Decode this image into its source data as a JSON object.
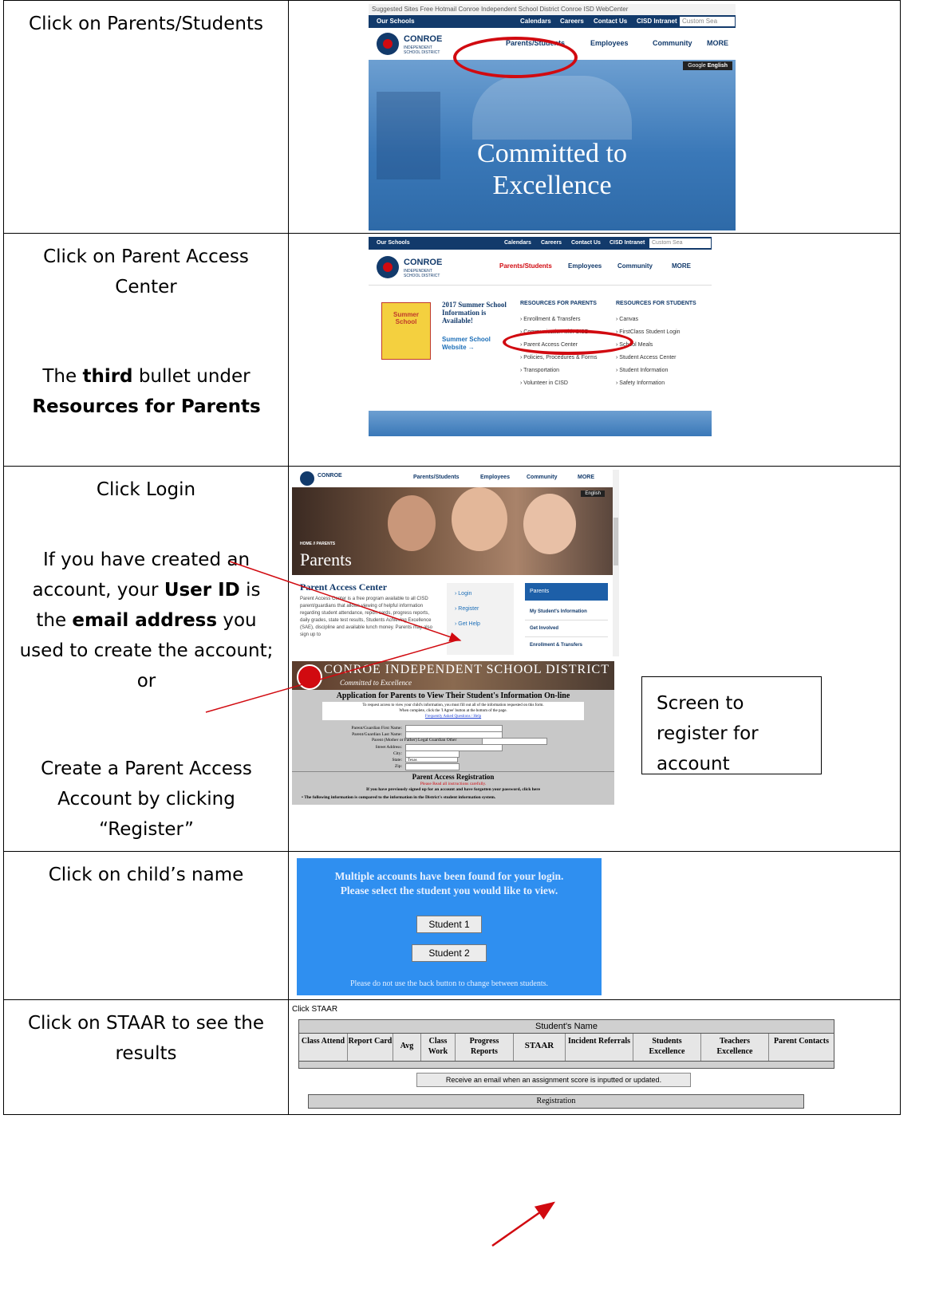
{
  "rows": [
    {
      "instruction": "Click on Parents/Students",
      "shot": {
        "browser_bar": "Suggested Sites  Free Hotmail  Conroe Independent School District  Conroe ISD WebCenter",
        "util_links": [
          "Our Schools",
          "Calendars",
          "Careers",
          "Contact Us",
          "CISD Intranet",
          "Custom Sea"
        ],
        "logo_name": "CONROE",
        "logo_sub": "INDEPENDENT SCHOOL DISTRICT",
        "nav": [
          "Parents/Students",
          "Employees",
          "Community",
          "MORE"
        ],
        "translate": "Google",
        "language": "English",
        "hero_line1": "Committed to",
        "hero_line2": "Excellence"
      }
    },
    {
      "instruction": "Click on Parent Access Center",
      "note_pre": "The ",
      "note_em": "third",
      "note_mid": " bullet under ",
      "note_strong": "Resources for Parents",
      "shot": {
        "util_links": [
          "Our Schools",
          "Calendars",
          "Careers",
          "Contact Us",
          "CISD Intranet",
          "Custom Sea"
        ],
        "logo_name": "CONROE",
        "logo_sub": "INDEPENDENT SCHOOL DISTRICT",
        "nav": [
          "Parents/Students",
          "Employees",
          "Community",
          "MORE"
        ],
        "promo_title": "2017 Summer School Information is Available!",
        "promo_link": "Summer School Website →",
        "promo_img": "Summer School",
        "parents_heading": "RESOURCES FOR PARENTS",
        "parents_items": [
          "Enrollment & Transfers",
          "Communication with CISD",
          "Parent Access Center",
          "Policies, Procedures & Forms",
          "Transportation",
          "Volunteer in CISD"
        ],
        "students_heading": "RESOURCES FOR STUDENTS",
        "students_items": [
          "Canvas",
          "FirstClass Student Login",
          "School Meals",
          "Student Access Center",
          "Student Information",
          "Safety Information"
        ]
      }
    },
    {
      "instruction": "Click Login",
      "note1_a": "If you have created an account, your ",
      "note1_b": "User ID",
      "note1_c": " is the ",
      "note1_d": "email address",
      "note1_e": " you used to create the account; or",
      "note2": "Create a Parent Access Account by clicking “Register”",
      "callout": "Screen to register for account",
      "shot_a": {
        "logo_name": "CONROE",
        "nav": [
          "Parents/Students",
          "Employees",
          "Community",
          "MORE"
        ],
        "language": "English",
        "crumb": "HOME // PARENTS",
        "page_title": "Parents",
        "pac_title": "Parent Access Center",
        "pac_body": "Parent Access Center is a free program available to all CISD parent/guardians that allows viewing of helpful information regarding student attendance, report cards, progress reports, daily grades, state test results, Students Achieving Excellence (SAE), discipline and available lunch money. Parents may also sign up to",
        "links": [
          "Login",
          "Register",
          "Get Help"
        ],
        "side_heading": "Parents",
        "side_items": [
          "My Student's Information",
          "Get Involved",
          "Enrollment & Transfers"
        ]
      },
      "shot_b": {
        "banner_title": "CONROE INDEPENDENT SCHOOL DISTRICT",
        "banner_motto": "Committed to Excellence",
        "app_title": "Application for Parents to View Their Student's Information On-line",
        "intro1": "To request access to view your child's information, you must fill out all of the information requested on this form.",
        "intro2": "When complete, click the 'I Agree' button at the bottom of the page.",
        "faq": "Frequently Asked Questions / Help",
        "fields": [
          "Parent/Guardian First Name:",
          "Parent/Guardian Last Name:",
          "Parent (Mother or Father)  Legal Guardian  Other",
          "Street Address:",
          "City:",
          "State:",
          "Zip:"
        ],
        "state_value": "Texas",
        "reg_title": "Parent Access Registration",
        "reg_warn": "Please Read all instructions carefully.",
        "reg_forgot": "If you have previously signed up for an account and have forgotten your password, click here",
        "reg_bullet": "The following information is compared to the information in the District's student information system."
      }
    },
    {
      "instruction": "Click on child’s name",
      "shot": {
        "msg_line1": "Multiple accounts have been found for your login.",
        "msg_line2": "Please select the student you would like to view.",
        "buttons": [
          "Student 1",
          "Student 2"
        ],
        "footer": "Please do not use the back button to change between students."
      }
    },
    {
      "instruction": "Click on STAAR to see the results",
      "shot": {
        "caption": "Click STAAR",
        "table_title": "Student's Name",
        "tabs": [
          "Class Attend",
          "Report Card",
          "Avg",
          "Class Work",
          "Progress Reports",
          "STAAR",
          "Incident Referrals",
          "Students Excellence",
          "Teachers Excellence",
          "Parent Contacts"
        ],
        "email_button": "Receive an email when an assignment score is inputted or updated.",
        "registration": "Registration"
      }
    }
  ],
  "colors": {
    "navy": "#123a6b",
    "annotation_red": "#d10a10",
    "student_select_blue": "#2f8ff0",
    "hero_blue": "#3a78b8"
  }
}
